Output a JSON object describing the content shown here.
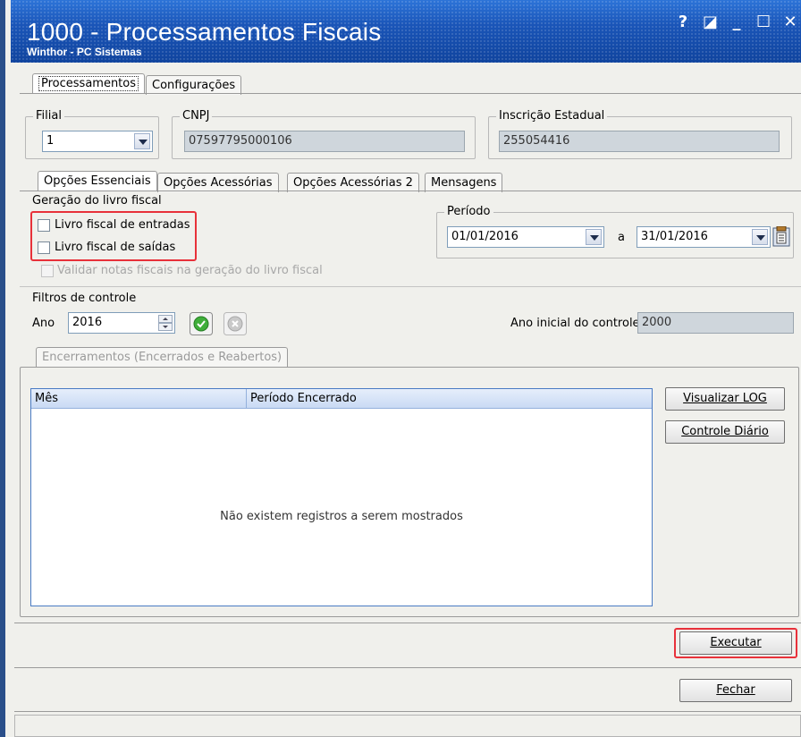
{
  "window": {
    "title": "1000 - Processamentos Fiscais",
    "subtitle": "Winthor - PC Sistemas",
    "controls": [
      "?",
      "◪",
      "_",
      "☐",
      "✕"
    ]
  },
  "main_tabs": [
    {
      "label": "Processamentos",
      "active": true
    },
    {
      "label": "Configurações",
      "active": false
    }
  ],
  "filial": {
    "legend": "Filial",
    "value": "1"
  },
  "cnpj": {
    "legend": "CNPJ",
    "value": "07597795000106"
  },
  "inscricao": {
    "legend": "Inscrição Estadual",
    "value": "255054416"
  },
  "sub_tabs": [
    {
      "label": "Opções Essenciais",
      "active": true
    },
    {
      "label": "Opções Acessórias",
      "active": false
    },
    {
      "label": "Opções Acessórias 2",
      "active": false
    },
    {
      "label": "Mensagens",
      "active": false
    }
  ],
  "geracao": {
    "legend": "Geração do livro fiscal",
    "entradas": "Livro fiscal de entradas",
    "saidas": "Livro fiscal de saídas",
    "validar": "Validar notas fiscais na geração do livro fiscal"
  },
  "periodo": {
    "legend": "Período",
    "from": "01/01/2016",
    "sep": "a",
    "to": "31/01/2016"
  },
  "filtros": {
    "legend": "Filtros de controle",
    "ano_label": "Ano",
    "ano_value": "2016",
    "ano_inicial_label": "Ano inicial do controle",
    "ano_inicial_value": "2000"
  },
  "encerramentos": {
    "tab": "Encerramentos (Encerrados e Reabertos)",
    "columns": [
      "Mês",
      "Período Encerrado"
    ],
    "empty_message": "Não existem registros a serem mostrados",
    "buttons": {
      "log": "Visualizar LOG",
      "diario": "Controle Diário"
    }
  },
  "actions": {
    "executar": "Executar",
    "fechar": "Fechar"
  },
  "colors": {
    "titlebar": "#1a55b8",
    "highlight": "#e8313a"
  }
}
